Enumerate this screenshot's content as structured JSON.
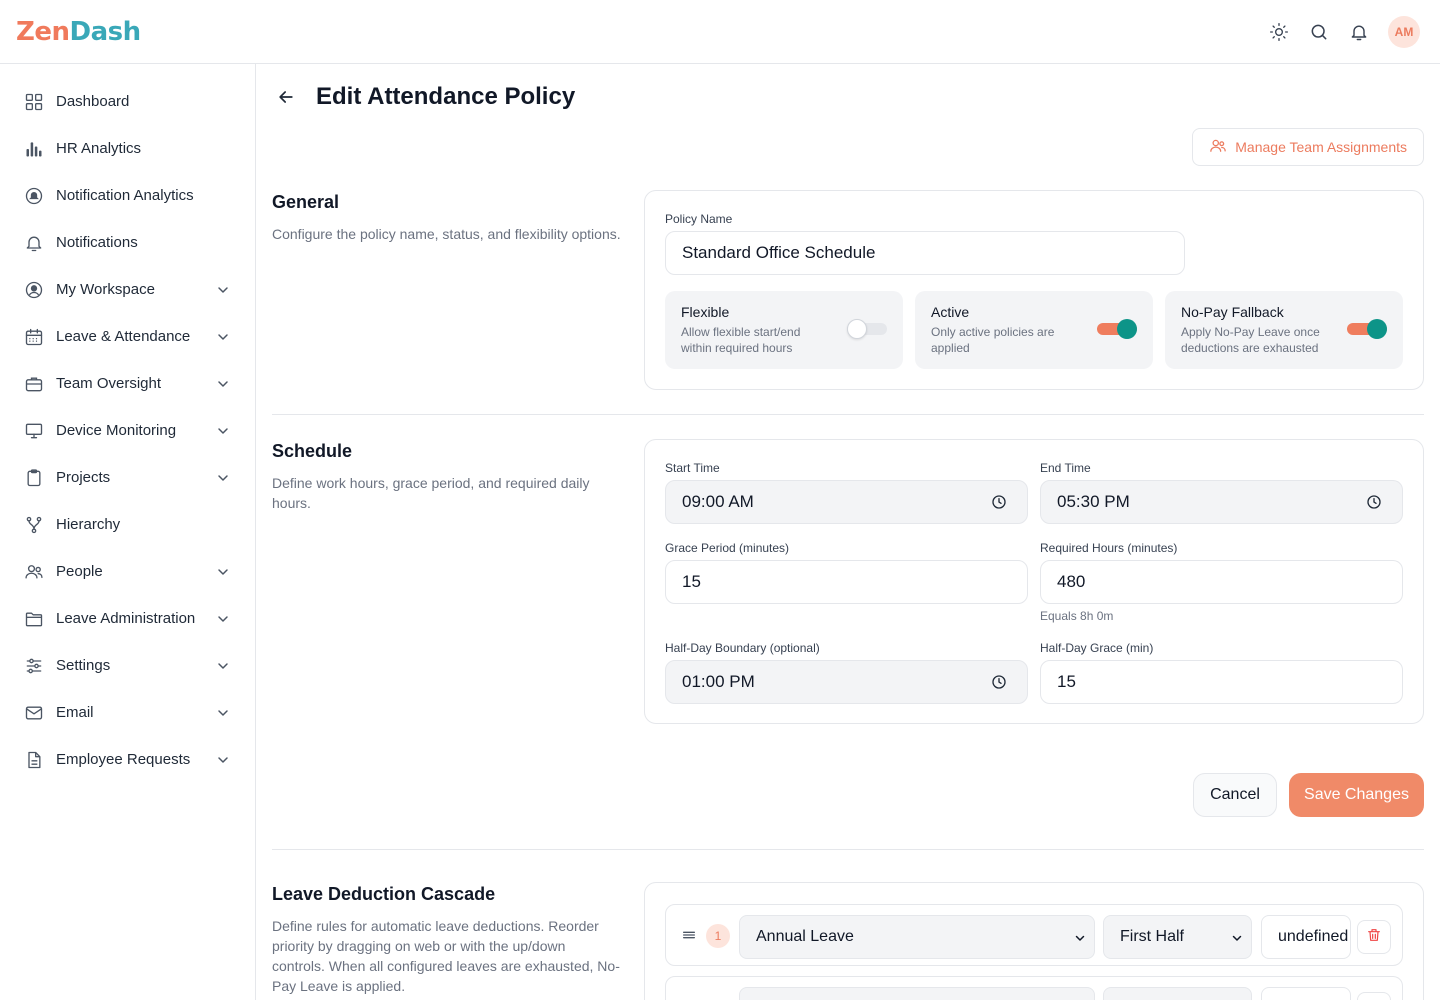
{
  "app": {
    "logo_left": "Zen",
    "logo_right": "Dash",
    "avatar_initials": "AM"
  },
  "colors": {
    "accent": "#ef7d5e",
    "teal": "#0d9488",
    "logo_orange": "#f07a5c",
    "logo_teal": "#3aa8b8"
  },
  "sidebar": {
    "items": [
      {
        "label": "Dashboard",
        "icon": "grid-icon",
        "has_chevron": false
      },
      {
        "label": "HR Analytics",
        "icon": "bar-chart-icon",
        "has_chevron": false
      },
      {
        "label": "Notification Analytics",
        "icon": "bell-circle-icon",
        "has_chevron": false
      },
      {
        "label": "Notifications",
        "icon": "bell-icon",
        "has_chevron": false
      },
      {
        "label": "My Workspace",
        "icon": "user-circle-icon",
        "has_chevron": true
      },
      {
        "label": "Leave & Attendance",
        "icon": "calendar-icon",
        "has_chevron": true
      },
      {
        "label": "Team Oversight",
        "icon": "briefcase-icon",
        "has_chevron": true
      },
      {
        "label": "Device Monitoring",
        "icon": "monitor-icon",
        "has_chevron": true
      },
      {
        "label": "Projects",
        "icon": "clipboard-icon",
        "has_chevron": true
      },
      {
        "label": "Hierarchy",
        "icon": "branch-icon",
        "has_chevron": false
      },
      {
        "label": "People",
        "icon": "users-icon",
        "has_chevron": true
      },
      {
        "label": "Leave Administration",
        "icon": "folder-icon",
        "has_chevron": true
      },
      {
        "label": "Settings",
        "icon": "sliders-icon",
        "has_chevron": true
      },
      {
        "label": "Email",
        "icon": "mail-icon",
        "has_chevron": true
      },
      {
        "label": "Employee Requests",
        "icon": "document-icon",
        "has_chevron": true
      }
    ]
  },
  "page": {
    "title": "Edit Attendance Policy",
    "manage_button": "Manage Team Assignments"
  },
  "general": {
    "title": "General",
    "description": "Configure the policy name, status, and flexibility options.",
    "policy_name_label": "Policy Name",
    "policy_name_value": "Standard Office Schedule",
    "toggles": [
      {
        "title": "Flexible",
        "description": "Allow flexible start/end within required hours",
        "on": false
      },
      {
        "title": "Active",
        "description": "Only active policies are applied",
        "on": true
      },
      {
        "title": "No-Pay Fallback",
        "description": "Apply No-Pay Leave once deductions are exhausted",
        "on": true
      }
    ]
  },
  "schedule": {
    "title": "Schedule",
    "description": "Define work hours, grace period, and required daily hours.",
    "start_time_label": "Start Time",
    "start_time_value": "09:00 AM",
    "end_time_label": "End Time",
    "end_time_value": "05:30 PM",
    "grace_label": "Grace Period (minutes)",
    "grace_value": "15",
    "required_label": "Required Hours (minutes)",
    "required_value": "480",
    "required_hint": "Equals 8h 0m",
    "halfday_label": "Half-Day Boundary (optional)",
    "halfday_value": "01:00 PM",
    "halfday_grace_label": "Half-Day Grace (min)",
    "halfday_grace_value": "15"
  },
  "actions": {
    "cancel": "Cancel",
    "save": "Save Changes"
  },
  "cascade": {
    "title": "Leave Deduction Cascade",
    "description": "Define rules for automatic leave deductions. Reorder priority by dragging on web or with the up/down controls. When all configured leaves are exhausted, No-Pay Leave is applied.",
    "rows": [
      {
        "priority": "1",
        "leave_type": "Annual Leave",
        "half": "First Half",
        "amount": "undefined"
      }
    ]
  }
}
